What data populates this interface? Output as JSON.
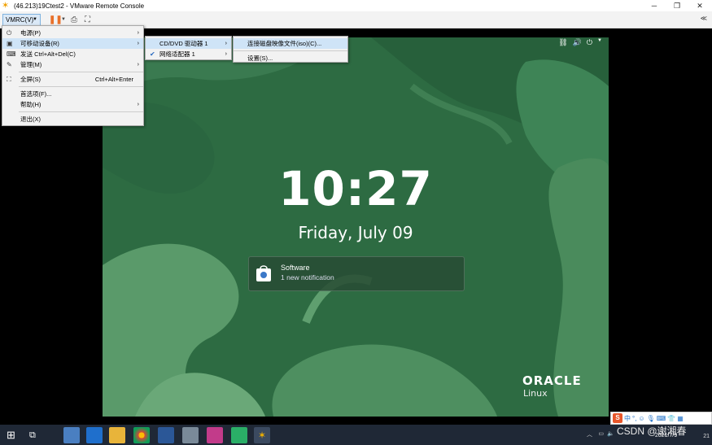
{
  "window": {
    "title": "(46.213)19Ctest2 - VMware Remote Console",
    "minimize": "─",
    "restore": "❐",
    "close": "✕"
  },
  "toolbar": {
    "vmrc_label": "VMRC(V)",
    "collapse": "≪"
  },
  "menu_main": {
    "items": [
      {
        "icon": "⏻",
        "label": "电源(P)",
        "shortcut": "",
        "submenu": true
      },
      {
        "icon": "▣",
        "label": "可移动设备(R)",
        "shortcut": "",
        "submenu": true
      },
      {
        "icon": "⌨",
        "label": "发送 Ctrl+Alt+Del(C)",
        "shortcut": "",
        "submenu": false
      },
      {
        "icon": "✎",
        "label": "管理(M)",
        "shortcut": "",
        "submenu": true
      },
      {
        "icon": "⛶",
        "label": "全屏(S)",
        "shortcut": "Ctrl+Alt+Enter",
        "submenu": false
      },
      {
        "icon": "",
        "label": "首选项(F)...",
        "shortcut": "",
        "submenu": false
      },
      {
        "icon": "",
        "label": "帮助(H)",
        "shortcut": "",
        "submenu": true
      },
      {
        "icon": "",
        "label": "退出(X)",
        "shortcut": "",
        "submenu": false
      }
    ]
  },
  "menu_devices": {
    "items": [
      {
        "label": "CD/DVD 驱动器 1",
        "check": ""
      },
      {
        "label": "网络适配器 1",
        "check": "✔"
      }
    ]
  },
  "menu_cd": {
    "items": [
      {
        "label": "连接磁盘映像文件(iso)(C)..."
      },
      {
        "label": "设置(S)..."
      }
    ]
  },
  "lockscreen": {
    "time": "10:27",
    "date": "Friday, July 09",
    "notification": {
      "title": "Software",
      "body": "1 new notification"
    },
    "brand": "ORACLE",
    "product": "Linux"
  },
  "ime": {
    "s": "S",
    "lang": "中"
  },
  "taskbar": {
    "date": "2021/7/9",
    "badge": "21"
  },
  "watermark": "CSDN @谢湘春"
}
